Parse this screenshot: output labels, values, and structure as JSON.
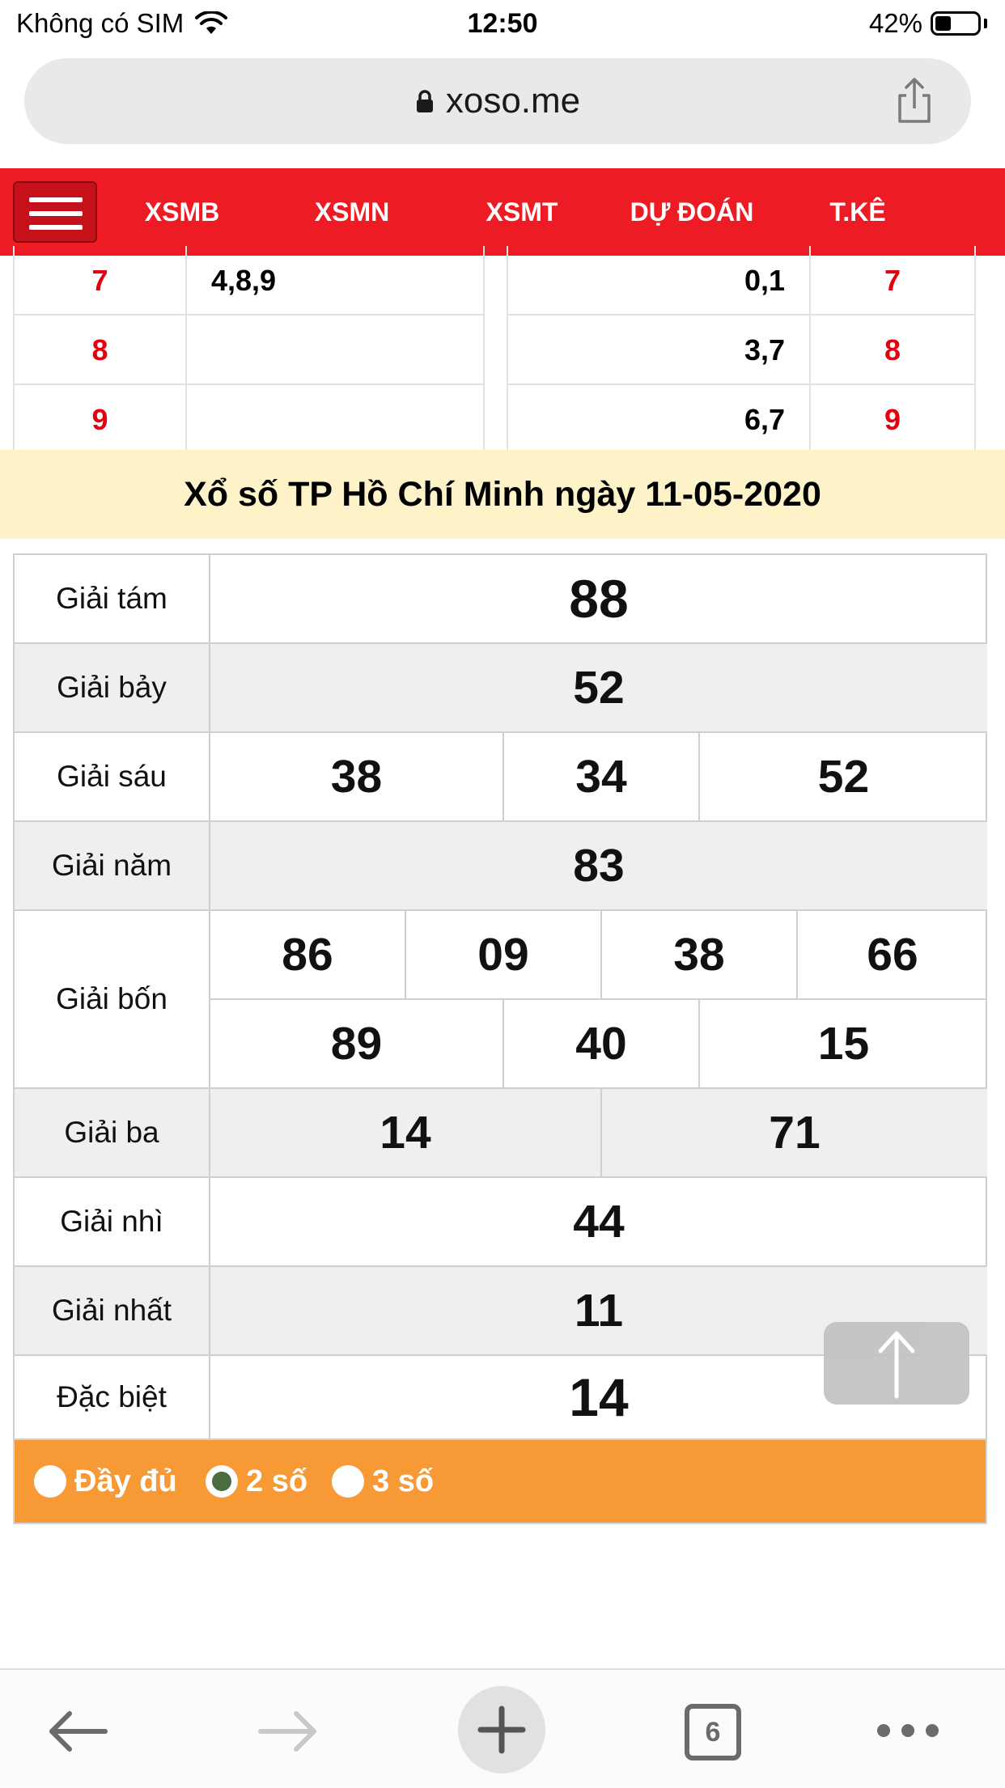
{
  "status": {
    "carrier": "Không có SIM",
    "time": "12:50",
    "battery": "42%"
  },
  "browser": {
    "url": "xoso.me",
    "tab_count": "6"
  },
  "nav": {
    "items": [
      "XSMB",
      "XSMN",
      "XSMT",
      "DỰ ĐOÁN",
      "T.KÊ"
    ]
  },
  "loto_partial": {
    "rows": [
      {
        "head": "7",
        "left": "4,8,9",
        "right": "0,1",
        "tail": "7"
      },
      {
        "head": "8",
        "left": "",
        "right": "3,7",
        "tail": "8"
      },
      {
        "head": "9",
        "left": "",
        "right": "6,7",
        "tail": "9"
      }
    ]
  },
  "result": {
    "title": "Xổ số TP Hồ Chí Minh ngày 11-05-2020",
    "labels": {
      "g8": "Giải tám",
      "g7": "Giải bảy",
      "g6": "Giải sáu",
      "g5": "Giải năm",
      "g4": "Giải bốn",
      "g3": "Giải ba",
      "g2": "Giải nhì",
      "g1": "Giải nhất",
      "db": "Đặc biệt"
    },
    "g8": "88",
    "g7": "52",
    "g6": [
      "38",
      "34",
      "52"
    ],
    "g5": "83",
    "g4_row1": [
      "86",
      "09",
      "38",
      "66"
    ],
    "g4_row2": [
      "89",
      "40",
      "15"
    ],
    "g3": [
      "14",
      "71"
    ],
    "g2": "44",
    "g1": "11",
    "db": "14"
  },
  "options": {
    "full": "Đầy đủ",
    "two": "2 số",
    "three": "3 số",
    "selected": "2 số"
  },
  "colors": {
    "nav": "#ed1c24",
    "accent_red": "#e3000f",
    "title_band": "#fdf2c8",
    "options_bar": "#f79a36"
  }
}
